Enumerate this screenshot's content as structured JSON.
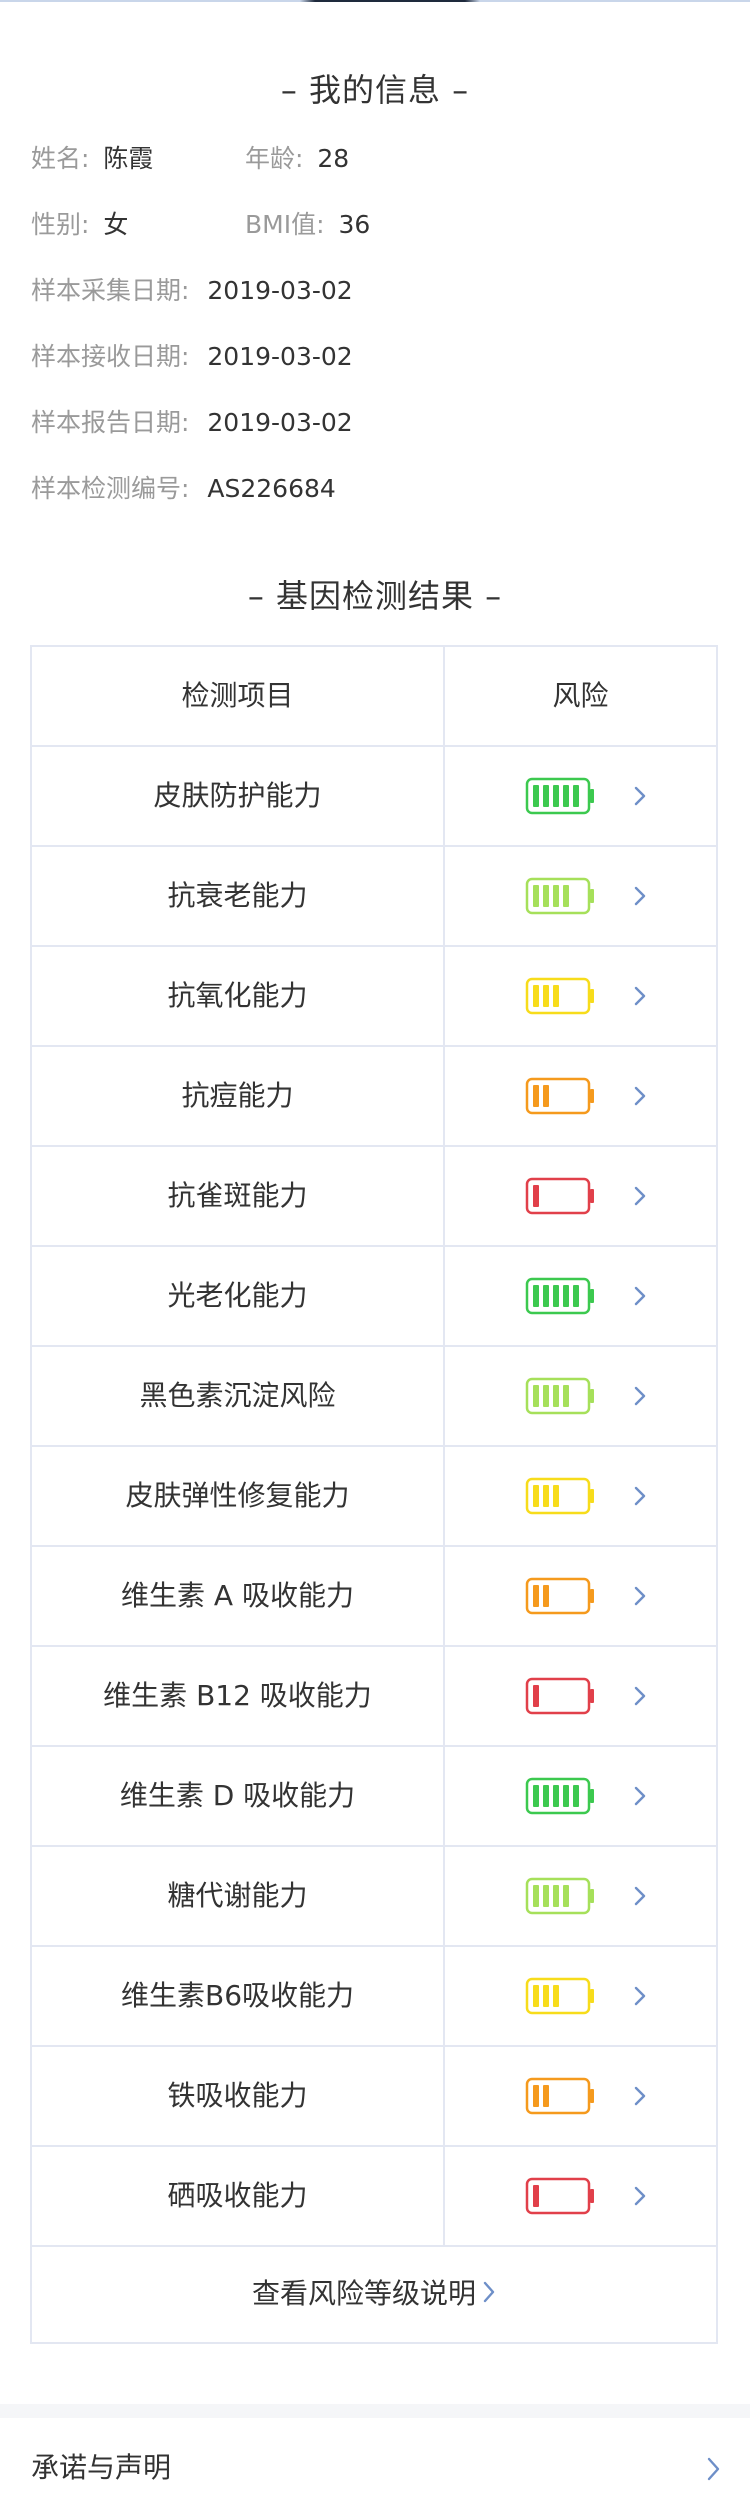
{
  "info": {
    "title": "– 我的信息 –",
    "name_label": "姓名:",
    "name_value": "陈霞",
    "age_label": "年龄:",
    "age_value": "28",
    "gender_label": "性别:",
    "gender_value": "女",
    "bmi_label": "BMI值:",
    "bmi_value": "36",
    "collect_label": "样本采集日期:",
    "collect_value": "2019-03-02",
    "receive_label": "样本接收日期:",
    "receive_value": "2019-03-02",
    "report_label": "样本报告日期:",
    "report_value": "2019-03-02",
    "code_label": "样本检测编号:",
    "code_value": "AS226684"
  },
  "results": {
    "title": "– 基因检测结果 –",
    "col_item": "检测项目",
    "col_risk": "风险",
    "rows": [
      {
        "name": "皮肤防护能力",
        "level": 5
      },
      {
        "name": "抗衰老能力",
        "level": 4
      },
      {
        "name": "抗氧化能力",
        "level": 3
      },
      {
        "name": "抗痘能力",
        "level": 2
      },
      {
        "name": "抗雀斑能力",
        "level": 1
      },
      {
        "name": "光老化能力",
        "level": 5
      },
      {
        "name": "黑色素沉淀风险",
        "level": 4
      },
      {
        "name": "皮肤弹性修复能力",
        "level": 3
      },
      {
        "name": "维生素 A 吸收能力",
        "level": 2
      },
      {
        "name": "维生素 B12 吸收能力",
        "level": 1
      },
      {
        "name": "维生素 D 吸收能力",
        "level": 5
      },
      {
        "name": "糖代谢能力",
        "level": 4
      },
      {
        "name": "维生素B6吸收能力",
        "level": 3
      },
      {
        "name": "铁吸收能力",
        "level": 2
      },
      {
        "name": "硒吸收能力",
        "level": 1
      }
    ],
    "footer_link": "查看风险等级说明"
  },
  "colors": {
    "level_5": "#3cc94f",
    "level_4": "#a6e05a",
    "level_3": "#f7dc1b",
    "level_2": "#f59a1d",
    "level_1": "#e1404a",
    "chevron": "#6e8fc8",
    "border": "#e3e7f2"
  },
  "icons": {
    "battery": "battery-icon",
    "chevron": "chevron-right-icon"
  },
  "promise": {
    "label": "承诺与声明"
  }
}
